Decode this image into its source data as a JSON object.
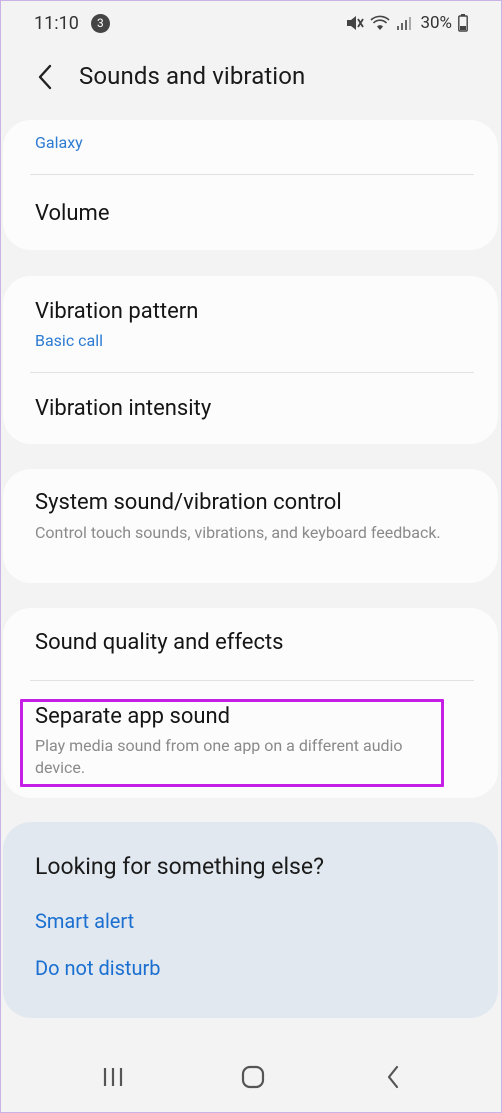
{
  "status_bar": {
    "time": "11:10",
    "notification_count": "3",
    "battery": "30%"
  },
  "header": {
    "title": "Sounds and vibration"
  },
  "card1": {
    "partial_subtitle": "Galaxy",
    "volume_label": "Volume"
  },
  "card2": {
    "vibration_pattern_label": "Vibration pattern",
    "vibration_pattern_value": "Basic call",
    "vibration_intensity_label": "Vibration intensity"
  },
  "card3": {
    "system_control_label": "System sound/vibration control",
    "system_control_desc": "Control touch sounds, vibrations, and keyboard feedback."
  },
  "card4": {
    "sound_quality_label": "Sound quality and effects",
    "separate_app_label": "Separate app sound",
    "separate_app_desc": "Play media sound from one app on a different audio device."
  },
  "looking": {
    "title": "Looking for something else?",
    "links": [
      "Smart alert",
      "Do not disturb"
    ]
  },
  "colors": {
    "accent_blue": "#2d7bd2",
    "highlight": "#c51fe7"
  }
}
